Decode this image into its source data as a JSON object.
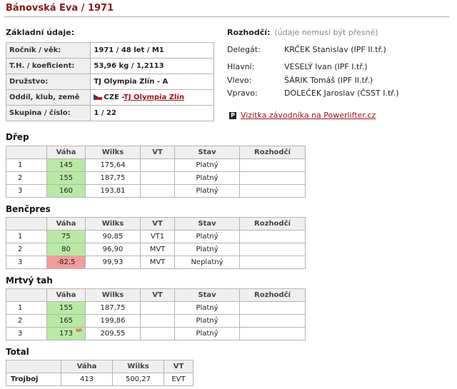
{
  "title": "Bánovská Eva / 1971",
  "basic": {
    "label": "Základní údaje:",
    "rows": [
      {
        "key": "Ročník / věk:",
        "value": "1971 / 48 let / M1"
      },
      {
        "key": "T.H. / koeficient:",
        "value": "53,96 kg / 1,2113"
      },
      {
        "key": "Družstvo:",
        "value": "TJ Olympia Zlín - A"
      },
      {
        "key": "Oddíl, klub, země",
        "country": "CZE",
        "club_prefix": " -",
        "club_link": "TJ Olympia Zlín",
        "flag": "czech-flag-icon"
      },
      {
        "key": "Skupina / číslo:",
        "value": "1 / 22"
      }
    ]
  },
  "referees": {
    "label": "Rozhodčí:",
    "note": "(údaje nemusí být přesné)",
    "rows": [
      {
        "role": "Delegát:",
        "name": "KRČEK Stanislav (IPF II.tř.)"
      },
      {
        "role": "Hlavní:",
        "name": "VESELÝ Ivan (IPF I.tř.)"
      },
      {
        "role": "Vlevo:",
        "name": "ŠÁRIK Tomáš (IPF II.tř.)"
      },
      {
        "role": "Vpravo:",
        "name": "DOLEČEK Jaroslav (ČSST I.tř.)"
      }
    ],
    "powerlifter_icon": "P",
    "powerlifter_link": "Vizitka závodníka na Powerlifter.cz"
  },
  "columns": [
    "",
    "Váha",
    "Wilks",
    "VT",
    "Stav",
    "Rozhodčí"
  ],
  "lifts": [
    {
      "name": "Dřep",
      "rows": [
        {
          "no": "1",
          "weight": "145",
          "wilks": "175,64",
          "vt": "",
          "status": "Platný",
          "ref": "",
          "color": "green",
          "nr": ""
        },
        {
          "no": "2",
          "weight": "155",
          "wilks": "187,75",
          "vt": "",
          "status": "Platný",
          "ref": "",
          "color": "green",
          "nr": ""
        },
        {
          "no": "3",
          "weight": "160",
          "wilks": "193,81",
          "vt": "",
          "status": "Platný",
          "ref": "",
          "color": "green",
          "nr": ""
        }
      ]
    },
    {
      "name": "Benčpres",
      "rows": [
        {
          "no": "1",
          "weight": "75",
          "wilks": "90,85",
          "vt": "VT1",
          "status": "Platný",
          "ref": "",
          "color": "green",
          "nr": ""
        },
        {
          "no": "2",
          "weight": "80",
          "wilks": "96,90",
          "vt": "MVT",
          "status": "Platný",
          "ref": "",
          "color": "green",
          "nr": ""
        },
        {
          "no": "3",
          "weight": "-82,5",
          "wilks": "99,93",
          "vt": "MVT",
          "status": "Neplatný",
          "ref": "",
          "color": "red",
          "nr": ""
        }
      ]
    },
    {
      "name": "Mrtvý tah",
      "rows": [
        {
          "no": "1",
          "weight": "155",
          "wilks": "187,75",
          "vt": "",
          "status": "Platný",
          "ref": "",
          "color": "green",
          "nr": ""
        },
        {
          "no": "2",
          "weight": "165",
          "wilks": "199,86",
          "vt": "",
          "status": "Platný",
          "ref": "",
          "color": "green",
          "nr": ""
        },
        {
          "no": "3",
          "weight": "173",
          "wilks": "209,55",
          "vt": "",
          "status": "Platný",
          "ref": "",
          "color": "green",
          "nr": "NR"
        }
      ]
    }
  ],
  "total": {
    "name": "Total",
    "columns": [
      "",
      "Váha",
      "Wilks",
      "VT"
    ],
    "row": {
      "label": "Trojboj",
      "weight": "413",
      "wilks": "500,27",
      "vt": "EVT"
    }
  }
}
